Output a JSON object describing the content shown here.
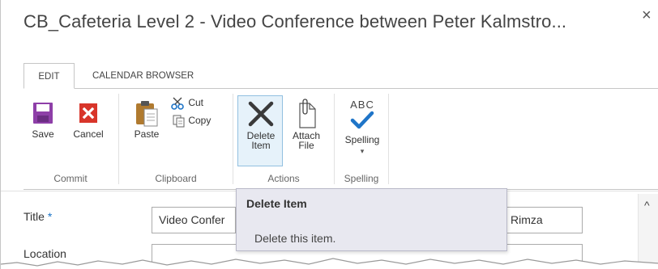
{
  "dialog": {
    "title": "CB_Cafeteria Level 2 - Video Conference between Peter Kalmstro...",
    "close_glyph": "×"
  },
  "tabs": [
    {
      "label": "EDIT",
      "active": true
    },
    {
      "label": "CALENDAR BROWSER",
      "active": false
    }
  ],
  "ribbon": {
    "groups": {
      "commit": {
        "label": "Commit",
        "save": "Save",
        "cancel": "Cancel"
      },
      "clipboard": {
        "label": "Clipboard",
        "paste": "Paste",
        "cut": "Cut",
        "copy": "Copy"
      },
      "actions": {
        "label": "Actions",
        "delete_line1": "Delete",
        "delete_line2": "Item",
        "attach_line1": "Attach",
        "attach_line2": "File"
      },
      "spelling": {
        "label": "Spelling",
        "spelling": "Spelling",
        "abc": "ABC"
      }
    }
  },
  "form": {
    "title_label": "Title",
    "required_mark": "*",
    "title_value_left": "Video Confer",
    "title_value_right": "Rimza",
    "location_label": "Location"
  },
  "tooltip": {
    "title": "Delete Item",
    "body": "Delete this item."
  },
  "colors": {
    "save_purple": "#8e3fa8",
    "cancel_red": "#d8352a",
    "spell_blue": "#1f75c8"
  }
}
